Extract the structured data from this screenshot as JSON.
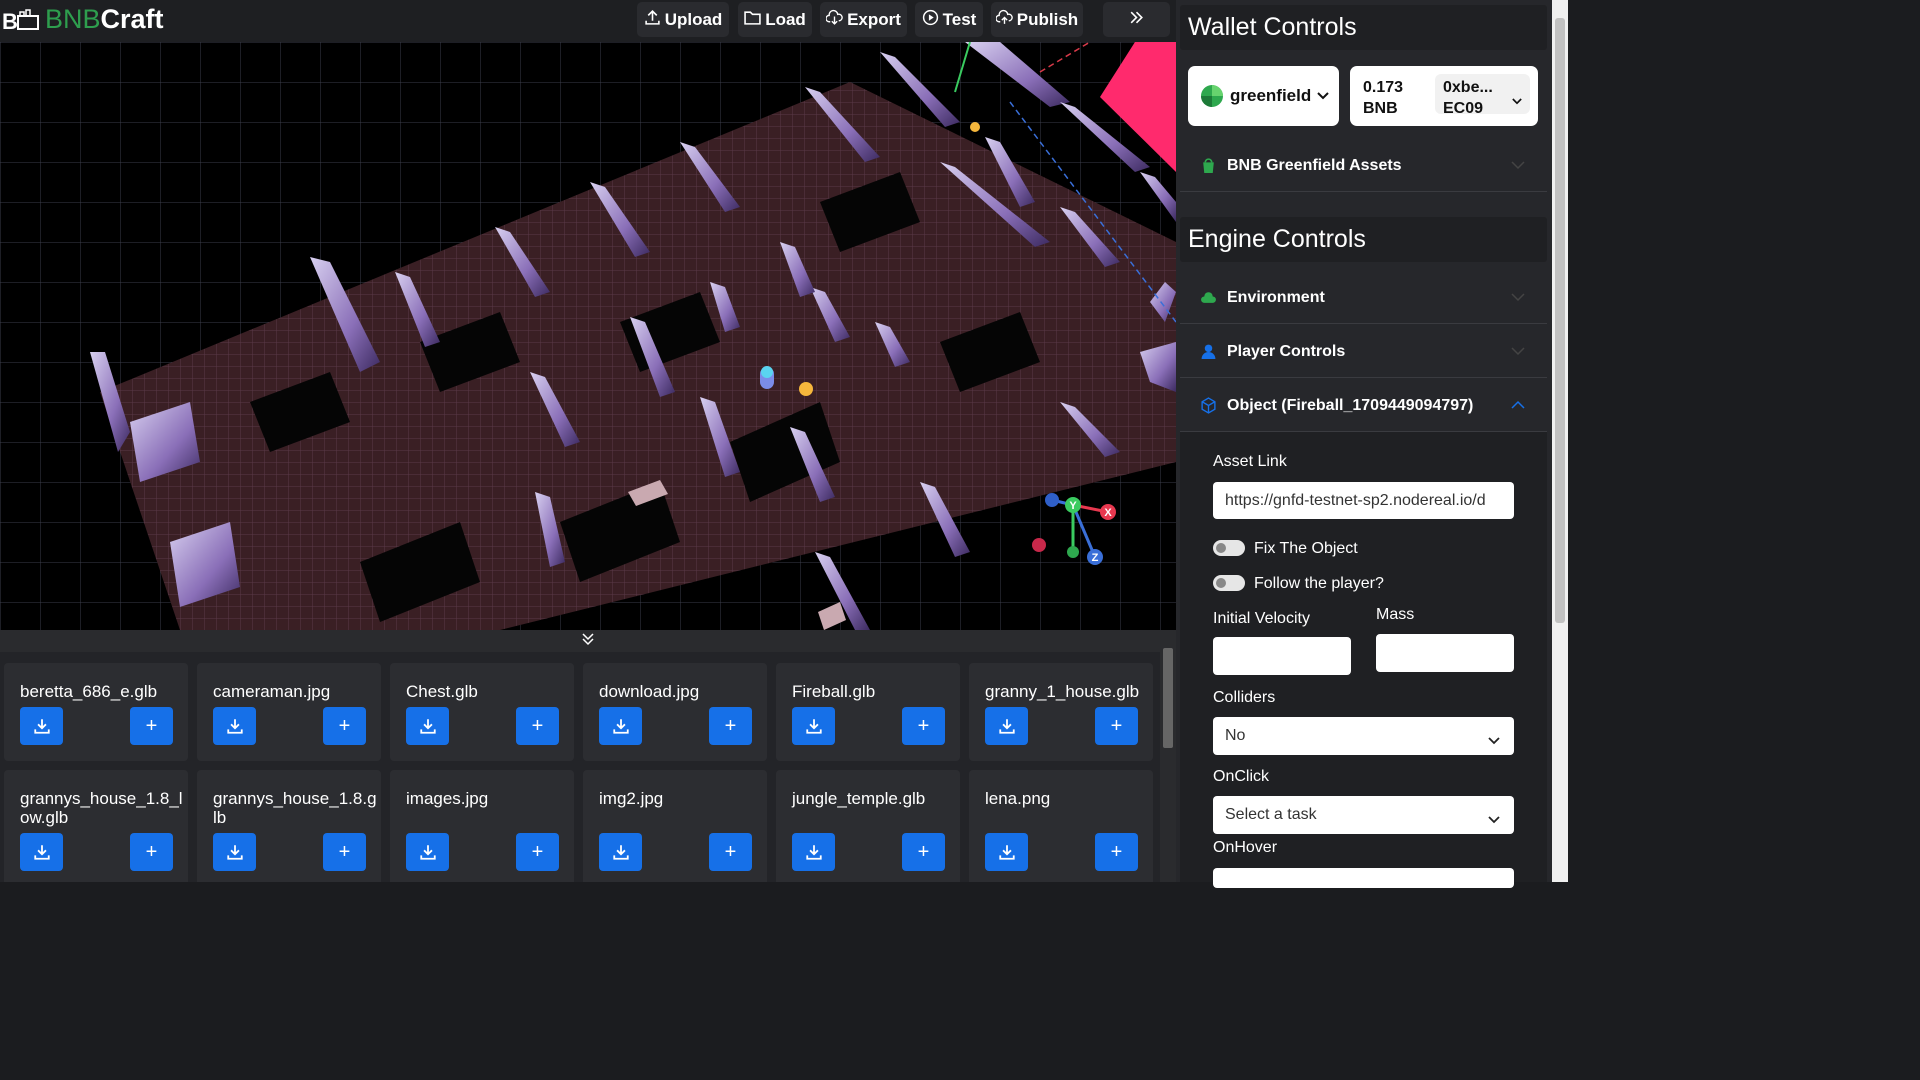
{
  "app": {
    "logo_prefix": "BNB",
    "logo_suffix": "Craft"
  },
  "toolbar": {
    "upload": "Upload",
    "load": "Load",
    "export": "Export",
    "test": "Test",
    "publish": "Publish"
  },
  "gizmo": {
    "x": "X",
    "y": "Y",
    "z": "Z"
  },
  "assets": {
    "items": [
      {
        "name": "beretta_686_e.glb"
      },
      {
        "name": "cameraman.jpg"
      },
      {
        "name": "Chest.glb"
      },
      {
        "name": "download.jpg"
      },
      {
        "name": "Fireball.glb"
      },
      {
        "name": "granny_1_house.glb"
      },
      {
        "name": "grannys_house_1.8_l ow.glb"
      },
      {
        "name": "grannys_house_1.8.g lb"
      },
      {
        "name": "images.jpg"
      },
      {
        "name": "img2.jpg"
      },
      {
        "name": "jungle_temple.glb"
      },
      {
        "name": "lena.png"
      }
    ],
    "add_label": "+"
  },
  "wallet": {
    "title": "Wallet Controls",
    "network": "greenfield",
    "balance_amount": "0.173",
    "balance_unit": "BNB",
    "address_line1": "0xbe...",
    "address_line2": "EC09",
    "assets_section": "BNB Greenfield Assets"
  },
  "engine": {
    "title": "Engine Controls",
    "environment": "Environment",
    "player_controls": "Player Controls",
    "object": "Object (Fireball_1709449094797)"
  },
  "object_form": {
    "asset_link_label": "Asset Link",
    "asset_link_value": "https://gnfd-testnet-sp2.nodereal.io/d",
    "fix_object": "Fix The Object",
    "follow_player": "Follow the player?",
    "initial_velocity": "Initial Velocity",
    "mass": "Mass",
    "initial_velocity_value": "",
    "mass_value": "",
    "colliders_label": "Colliders",
    "colliders_value": "No",
    "onclick_label": "OnClick",
    "onclick_value": "Select a task",
    "onhover_label": "OnHover"
  },
  "colors": {
    "accent": "#1670e8",
    "brand_green": "#2e9e4e",
    "panel": "#26272b"
  }
}
